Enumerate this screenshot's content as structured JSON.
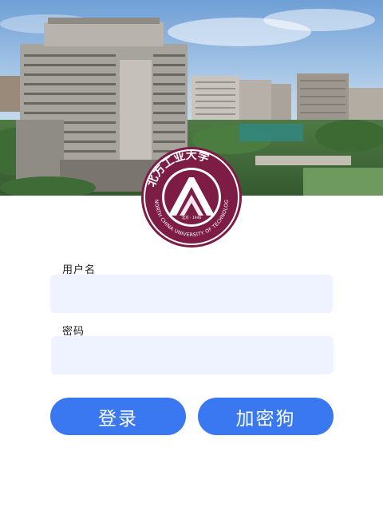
{
  "app": {
    "logo_lettering": "北方工业大学 NORTH CHINA UNIVERSITY OF TECHNOLOGY 北京·1946"
  },
  "form": {
    "username_label": "用户名",
    "username_value": "",
    "username_placeholder": "",
    "password_label": "密码",
    "password_value": "",
    "password_placeholder": ""
  },
  "buttons": {
    "login_label": "登录",
    "dongle_label": "加密狗"
  },
  "colors": {
    "accent": "#3a78f2",
    "field_bg": "#eef3ff",
    "logo": "#7d1d46"
  },
  "icons": {
    "logo": "university-seal-icon"
  }
}
